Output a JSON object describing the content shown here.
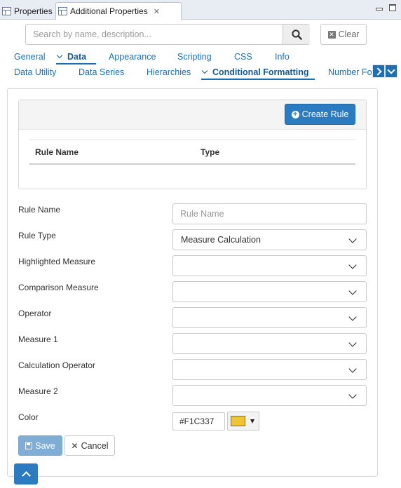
{
  "view_tabs": [
    {
      "label": "Properties"
    },
    {
      "label": "Additional Properties",
      "close_glyph": "✕"
    }
  ],
  "search": {
    "placeholder": "Search by name, description...",
    "value": "",
    "clear_label": "Clear"
  },
  "tabs_row1": [
    {
      "label": "General"
    },
    {
      "label": "Data",
      "active": true
    },
    {
      "label": "Appearance"
    },
    {
      "label": "Scripting"
    },
    {
      "label": "CSS"
    },
    {
      "label": "Info"
    }
  ],
  "tabs_row2": [
    {
      "label": "Data Utility"
    },
    {
      "label": "Data Series"
    },
    {
      "label": "Hierarchies"
    },
    {
      "label": "Conditional Formatting",
      "active": true
    },
    {
      "label": "Number For"
    }
  ],
  "rules": {
    "create_label": "Create Rule",
    "columns": [
      "Rule Name",
      "Type"
    ],
    "rows": []
  },
  "form": {
    "rule_name": {
      "label": "Rule Name",
      "placeholder": "Rule Name",
      "value": ""
    },
    "rule_type": {
      "label": "Rule Type",
      "value": "Measure Calculation"
    },
    "highlighted_measure": {
      "label": "Highlighted Measure",
      "value": ""
    },
    "comparison_measure": {
      "label": "Comparison Measure",
      "value": ""
    },
    "operator": {
      "label": "Operator",
      "value": ""
    },
    "measure1": {
      "label": "Measure 1",
      "value": ""
    },
    "calculation_operator": {
      "label": "Calculation Operator",
      "value": ""
    },
    "measure2": {
      "label": "Measure 2",
      "value": ""
    },
    "color": {
      "label": "Color",
      "value": "#F1C337",
      "swatch": "#F1C337"
    }
  },
  "buttons": {
    "save": "Save",
    "cancel": "Cancel"
  },
  "colors": {
    "accent": "#2b7bc0",
    "link": "#1f6fb5",
    "save_disabled": "#7fadd6"
  }
}
